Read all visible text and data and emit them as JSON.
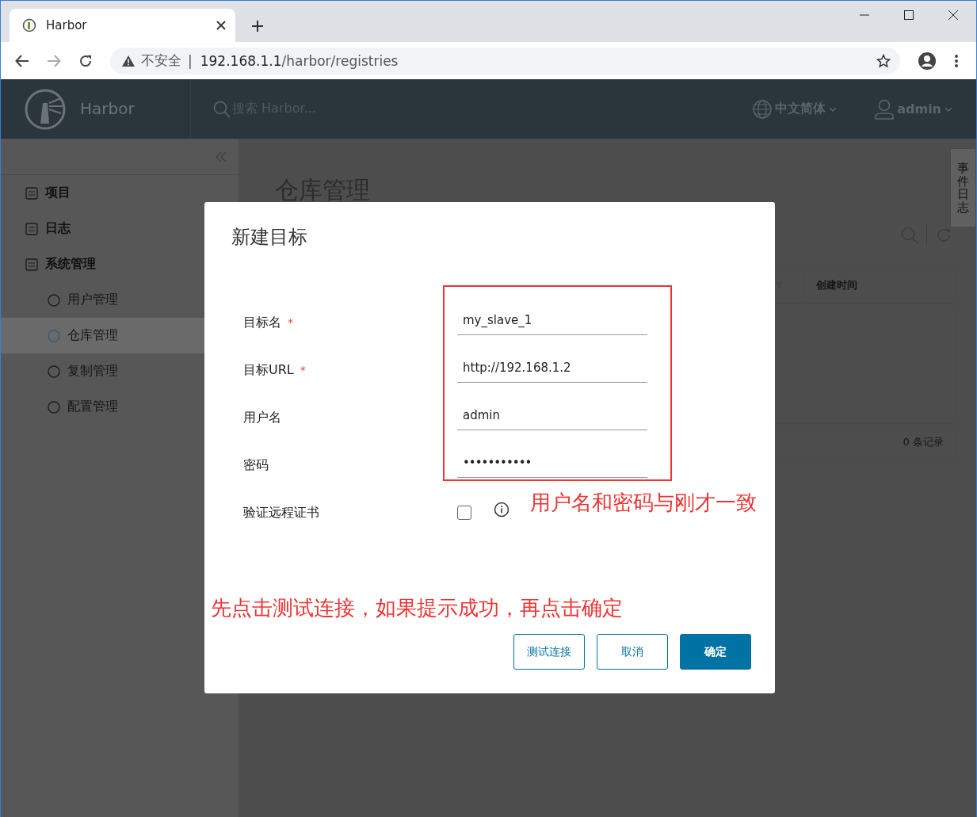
{
  "browser": {
    "tab_title": "Harbor",
    "security_label": "不安全",
    "separator": "|",
    "url_host": "192.168.1.1",
    "url_path": "/harbor/registries"
  },
  "header": {
    "brand": "Harbor",
    "search_placeholder": "搜索 Harbor...",
    "language": "中文简体",
    "user": "admin"
  },
  "sidebar": {
    "items": [
      {
        "label": "项目",
        "selected": false
      },
      {
        "label": "日志",
        "selected": false
      },
      {
        "label": "系统管理",
        "selected": false,
        "children": [
          {
            "label": "用户管理",
            "selected": false
          },
          {
            "label": "仓库管理",
            "selected": true
          },
          {
            "label": "复制管理",
            "selected": false
          },
          {
            "label": "配置管理",
            "selected": false
          }
        ]
      }
    ]
  },
  "page": {
    "title": "仓库管理",
    "table": {
      "columns": [
        {
          "label": "创建时间"
        }
      ],
      "footer": "0 条记录"
    },
    "side_tab": "事件日志"
  },
  "dialog": {
    "title": "新建目标",
    "required_marker": "*",
    "fields": [
      {
        "kind": "text",
        "label": "目标名",
        "required": true,
        "value": "my_slave_1"
      },
      {
        "kind": "text",
        "label": "目标URL",
        "required": true,
        "value": "http://192.168.1.2"
      },
      {
        "kind": "text",
        "label": "用户名",
        "required": false,
        "value": "admin"
      },
      {
        "kind": "password",
        "label": "密码",
        "required": false,
        "value": "•••••••••••"
      },
      {
        "kind": "checkbox",
        "label": "验证远程证书",
        "required": false,
        "checked": false
      }
    ],
    "buttons": [
      {
        "label": "测试连接",
        "kind": "outline"
      },
      {
        "label": "取消",
        "kind": "outline"
      },
      {
        "label": "确定",
        "kind": "primary"
      }
    ]
  },
  "annotations": [
    {
      "text": "用户名和密码与刚才一致"
    },
    {
      "text": "先点击测试连接，如果提示成功，再点击确定"
    }
  ]
}
